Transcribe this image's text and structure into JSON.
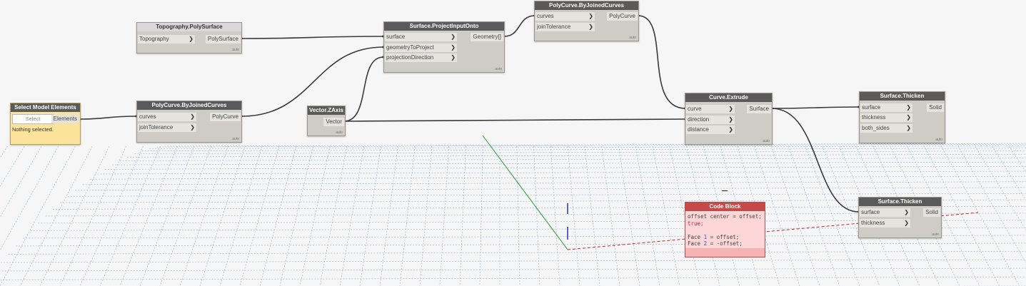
{
  "nodes": {
    "topography": {
      "title": "Topography.PolySurface",
      "inputs": [
        "Topography"
      ],
      "output": "PolySurface",
      "lacing": "auto"
    },
    "select_model": {
      "title": "Select Model Elements",
      "select_button": "Select",
      "output": "Elements",
      "status": "Nothing selected."
    },
    "polycurve1": {
      "title": "PolyCurve.ByJoinedCurves",
      "inputs": [
        "curves",
        "joinTolerance"
      ],
      "output": "PolyCurve",
      "lacing": "auto"
    },
    "project": {
      "title": "Surface.ProjectInputOnto",
      "inputs": [
        "surface",
        "geometryToProject",
        "projectionDirection"
      ],
      "output": "Geometry[]",
      "lacing": "auto"
    },
    "polycurve2": {
      "title": "PolyCurve.ByJoinedCurves",
      "inputs": [
        "curves",
        "joinTolerance"
      ],
      "output": "PolyCurve",
      "lacing": "auto"
    },
    "vector": {
      "title": "Vector.ZAxis",
      "output": "Vector",
      "lacing": "auto"
    },
    "extrude": {
      "title": "Curve.Extrude",
      "inputs": [
        "curve",
        "direction",
        "distance"
      ],
      "output": "Surface",
      "lacing": "auto"
    },
    "thicken1": {
      "title": "Surface.Thicken",
      "inputs": [
        "surface",
        "thickness",
        "both_sides"
      ],
      "output": "Solid",
      "lacing": "auto"
    },
    "thicken2": {
      "title": "Surface.Thicken",
      "inputs": [
        "surface",
        "thickness"
      ],
      "output": "Solid",
      "lacing": "auto"
    },
    "codeblock": {
      "title": "Code Block",
      "line1": "offset center = offset;",
      "line2": "true;",
      "line3a": "Face ",
      "line3n": "1",
      "line3b": " = offset;",
      "line4a": "Face ",
      "line4n": "2",
      "line4b": " = -offset;"
    }
  },
  "arrow_glyph": "❯",
  "colors": {
    "node_body": "#cfcbc5",
    "node_header": "#5a5a5a",
    "code_block_header": "#c44a4a",
    "code_block_body": "#fdd7d7",
    "select_node_body": "#fce39b",
    "wire": "#3a3a3a"
  }
}
